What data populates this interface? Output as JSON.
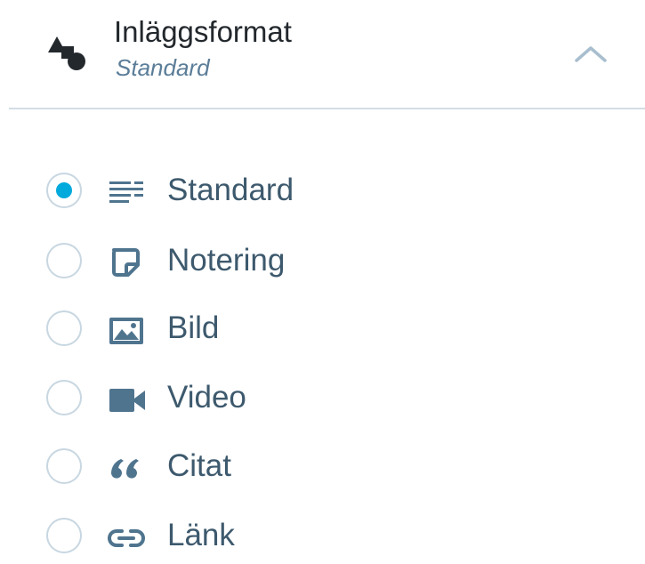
{
  "header": {
    "title": "Inläggsformat",
    "subtitle": "Standard",
    "icon": "post-format-shapes-icon",
    "toggle_icon": "chevron-up-icon"
  },
  "colors": {
    "accent": "#00aadc",
    "label": "#3d596d",
    "subtitle": "#5b7d98",
    "icon": "#4f748e",
    "divider": "#d3dde4"
  },
  "formats": [
    {
      "label": "Standard",
      "icon": "standard-lines-icon",
      "selected": true
    },
    {
      "label": "Notering",
      "icon": "note-icon",
      "selected": false
    },
    {
      "label": "Bild",
      "icon": "image-icon",
      "selected": false
    },
    {
      "label": "Video",
      "icon": "video-camera-icon",
      "selected": false
    },
    {
      "label": "Citat",
      "icon": "quote-icon",
      "selected": false
    },
    {
      "label": "Länk",
      "icon": "link-icon",
      "selected": false
    }
  ]
}
